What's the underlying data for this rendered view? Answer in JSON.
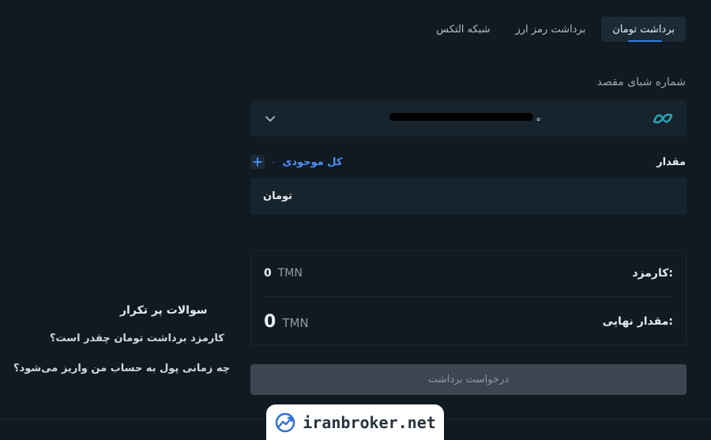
{
  "tabs": [
    {
      "label": "برداشت تومان",
      "active": true
    },
    {
      "label": "برداشت رمز ارز",
      "active": false
    },
    {
      "label": "شبکه التکس",
      "active": false
    }
  ],
  "sheba": {
    "label": "شماره شبای مقصد",
    "masked_suffix": "ه",
    "bank_logo_icon": "bank-logo-icon",
    "chevron_icon": "chevron-down-icon"
  },
  "amount": {
    "label": "مقدار",
    "balance_label": "کل موجودی",
    "balance_value": "۰",
    "unit": "تومان"
  },
  "summary": {
    "fee_label": "کارمزد:",
    "fee_value": "0",
    "fee_currency": "TMN",
    "final_label": "مقدار نهایی:",
    "final_value": "0",
    "final_currency": "TMN"
  },
  "submit": {
    "label": "درخواست برداشت"
  },
  "faq": {
    "title": "سوالات پر تکرار",
    "items": [
      "کارمزد برداشت تومان چقدر است؟",
      "چه زمانی پول به حساب من واریز می‌شود؟"
    ]
  },
  "watermark": {
    "text": "iranbroker.net"
  },
  "colors": {
    "background": "#0f1a22",
    "panel": "#17232d",
    "accent": "#2f7fe6",
    "link": "#4f8ff7",
    "disabled_button": "#3b4650"
  }
}
